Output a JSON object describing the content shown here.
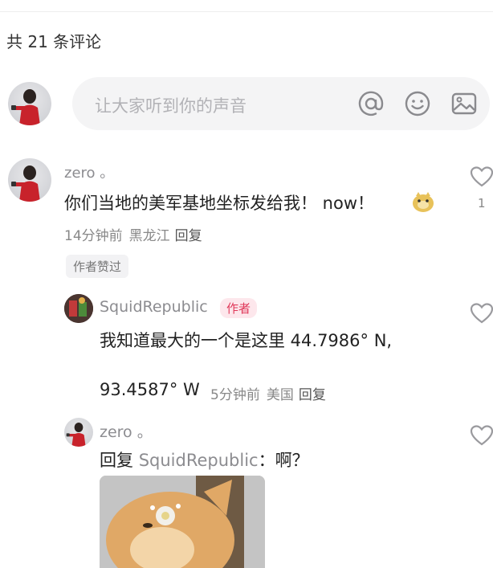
{
  "comments_header": {
    "count_text": "共 21 条评论"
  },
  "input": {
    "placeholder": "让大家听到你的声音"
  },
  "comments": [
    {
      "username": "zero 。",
      "text": "你们当地的美军基地坐标发给我！ now！",
      "emoji": "doge-emoji",
      "time": "14分钟前",
      "location": "黑龙江",
      "reply_label": "回复",
      "badge": "作者赞过",
      "likes": "1"
    }
  ],
  "replies": [
    {
      "username": "SquidRepublic",
      "author_tag": "作者",
      "text_line1": "我知道最大的一个是这里 44.7986°   N,",
      "text_line2": "93.4587°   W",
      "time": "5分钟前",
      "location": "美国",
      "reply_label": "回复"
    },
    {
      "username": "zero 。",
      "reply_prefix": "回复",
      "reply_to": "SquidRepublic",
      "reply_text": "：啊？",
      "image": "cat-photo"
    }
  ],
  "colors": {
    "author_tag": "#e0395a",
    "secondary_text": "#888888"
  }
}
